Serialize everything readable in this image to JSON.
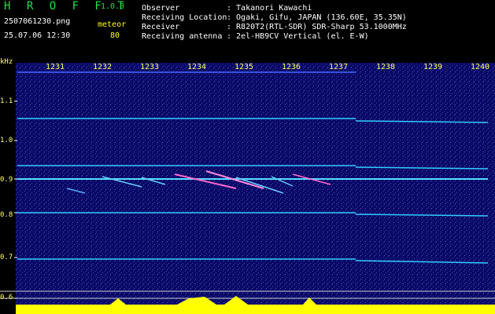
{
  "header": {
    "app_name": "H R O F F T",
    "version": "1.0.0",
    "filename": "2507061230.png",
    "datetime": "25.07.06 12:30",
    "meteor_label": "meteor",
    "meteor_count": "80",
    "rows": [
      {
        "label": "Observer",
        "value": ": Takanori Kawachi"
      },
      {
        "label": "Receiving Location",
        "value": ": Ogaki, Gifu, JAPAN (136.60E, 35.35N)"
      },
      {
        "label": "Receiver",
        "value": ": R820T2(RTL-SDR) SDR-Sharp 53.1000MHz"
      },
      {
        "label": "Receiving antenna",
        "value": ": 2el-HB9CV Vertical (el. E-W)"
      }
    ]
  },
  "axes": {
    "y_unit": "kHz",
    "y_ticks": [
      "1.1",
      "1.0",
      "0.9",
      "0.8",
      "0.7",
      "0.6"
    ],
    "x_ticks": [
      "1231",
      "1232",
      "1233",
      "1234",
      "1235",
      "1236",
      "1237",
      "1238",
      "1239",
      "1240"
    ]
  },
  "colors": {
    "background": "#0a0a60",
    "signal": "#33ccff",
    "meteor": "#ff66cc",
    "bottom_bars": "#ffff00"
  }
}
